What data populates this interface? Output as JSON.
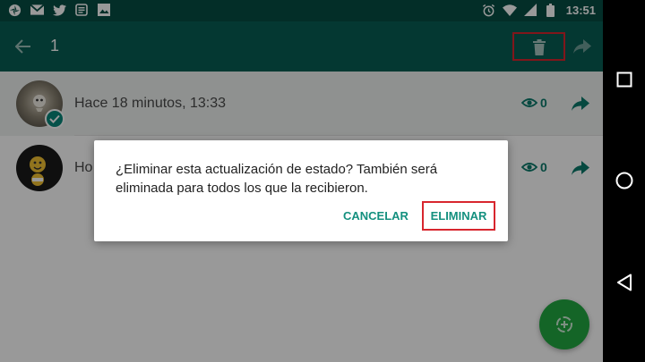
{
  "status_bar": {
    "time": "13:51",
    "left_icons": [
      "pinwheel-icon",
      "gmail-icon",
      "twitter-icon",
      "news-icon",
      "image-icon"
    ],
    "right_icons": [
      "alarm-icon",
      "wifi-icon",
      "signal-icon",
      "battery-icon"
    ]
  },
  "app_bar": {
    "back_icon": "arrow-back-icon",
    "selected_count": "1",
    "delete_icon": "trash-icon",
    "share_icon": "forward-icon"
  },
  "status_list": [
    {
      "text": "Hace 18 minutos, 13:33",
      "views": "0",
      "selected": true
    },
    {
      "text": "Ho",
      "views": "0",
      "selected": false
    }
  ],
  "dialog": {
    "message": "¿Eliminar esta actualización de estado? También será eliminada para todos los que la recibieron.",
    "cancel_label": "CANCELAR",
    "confirm_label": "ELIMINAR"
  },
  "fab_icon": "add-status-icon",
  "nav_bar": {
    "icons": [
      "recents-icon",
      "home-icon",
      "back-icon"
    ]
  },
  "colors": {
    "appbar": "#075e54",
    "statusbar": "#054d44",
    "accent": "#14907f",
    "fab": "#22a842",
    "highlight": "#d8262e"
  }
}
